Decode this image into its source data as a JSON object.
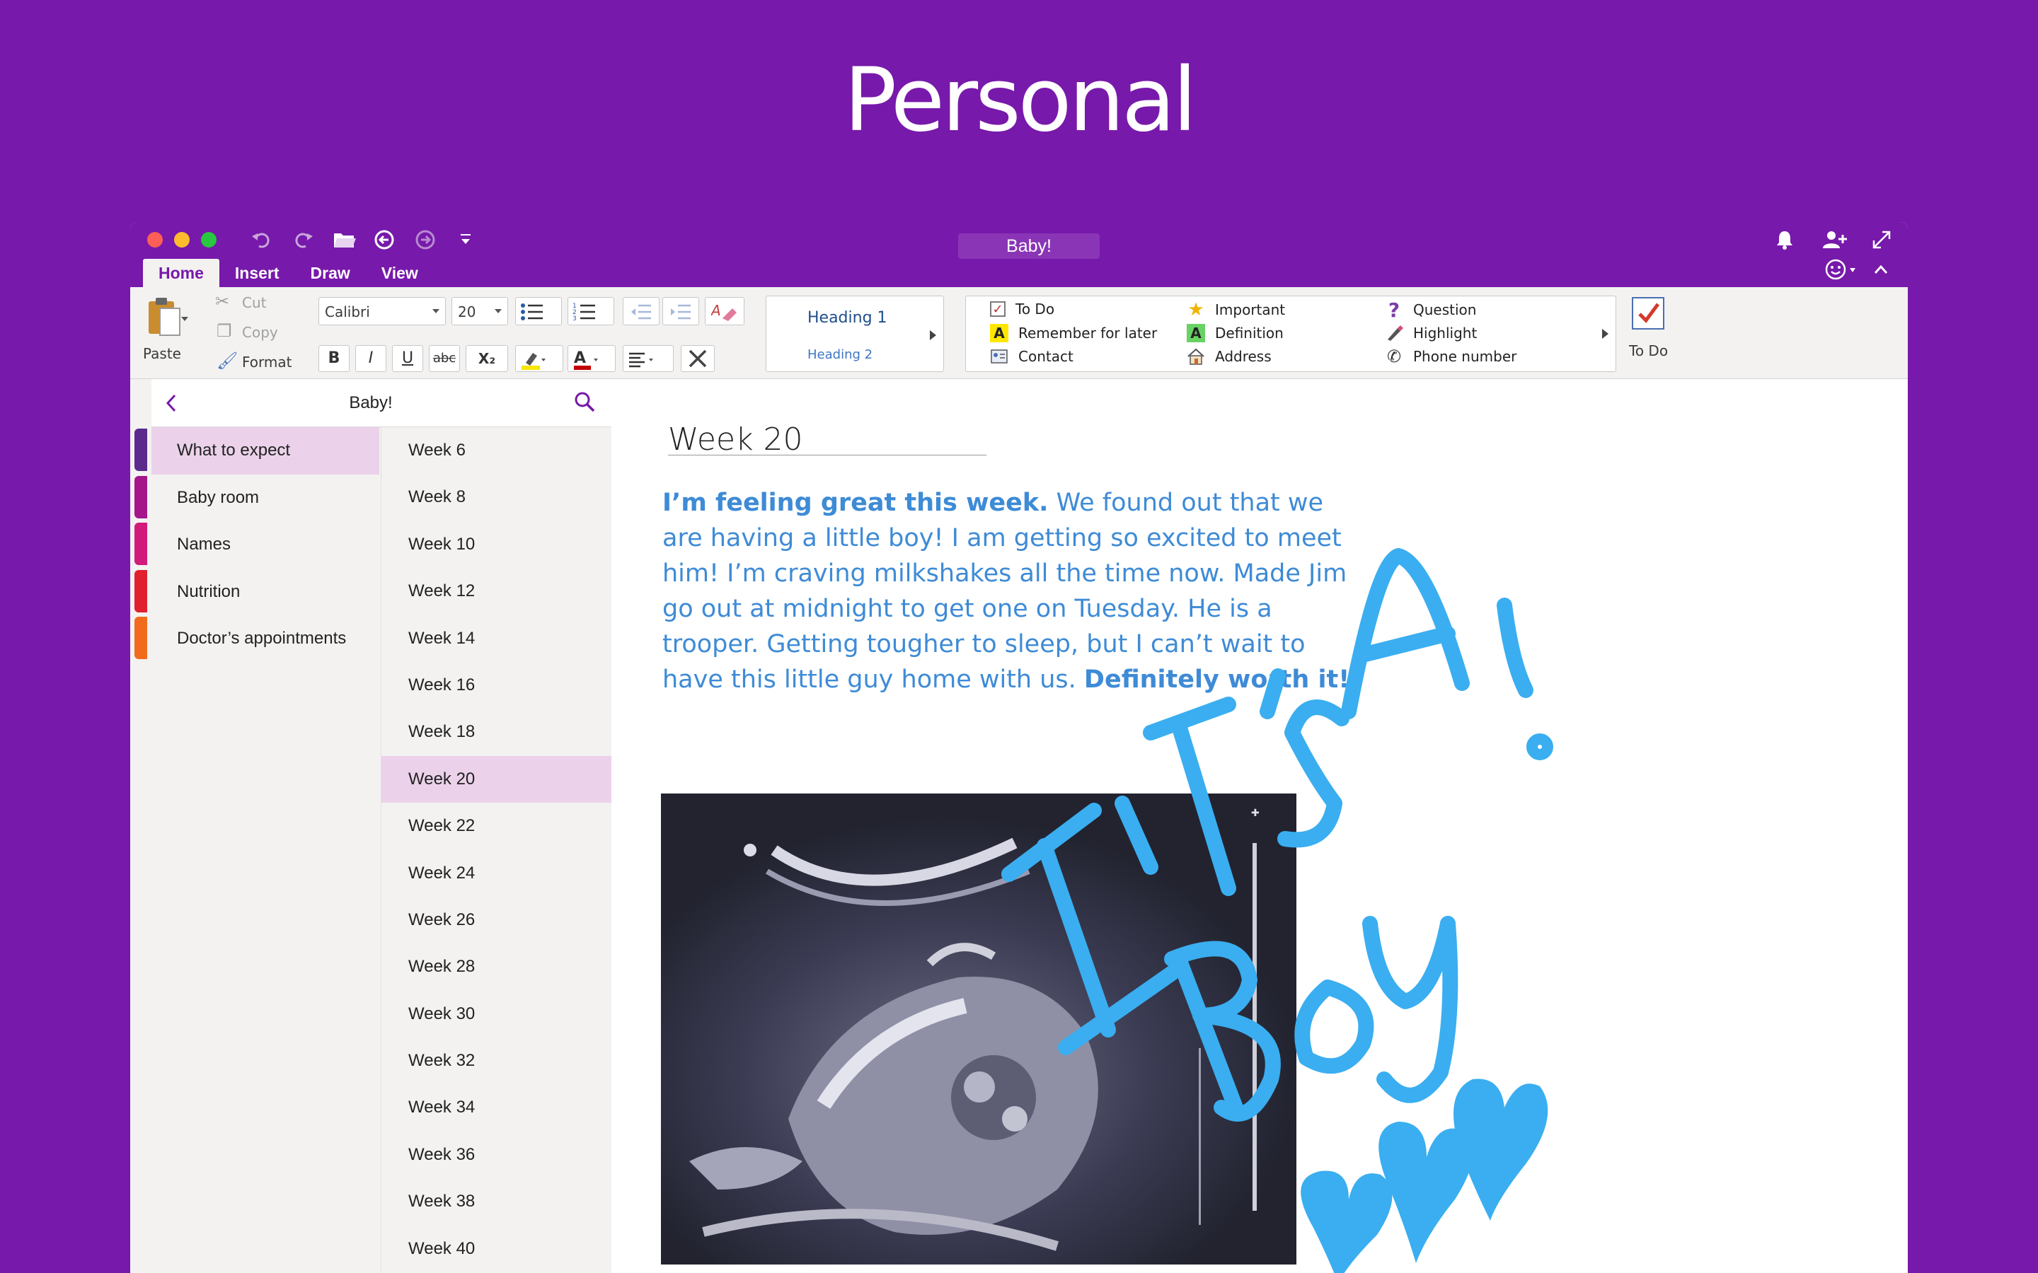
{
  "hero": {
    "title": "Personal"
  },
  "window": {
    "title": "Baby!",
    "tabs": [
      "Home",
      "Insert",
      "Draw",
      "View"
    ],
    "active_tab": "Home"
  },
  "ribbon": {
    "paste": "Paste",
    "cut": "Cut",
    "copy": "Copy",
    "format": "Format",
    "font_name": "Calibri",
    "font_size": "20",
    "bold": "B",
    "italic": "I",
    "underline": "U",
    "strike": "abc",
    "subscript": "X₂",
    "styles": {
      "heading1": "Heading 1",
      "heading2": "Heading 2"
    },
    "tags": {
      "todo": "To Do",
      "remember": "Remember for later",
      "contact": "Contact",
      "important": "Important",
      "definition": "Definition",
      "address": "Address",
      "question": "Question",
      "highlight": "Highlight",
      "phone": "Phone number"
    },
    "todo_button": "To Do"
  },
  "navigation": {
    "notebook_title": "Baby!",
    "sections": [
      {
        "label": "What to expect",
        "color": "#5b2a8c"
      },
      {
        "label": "Baby room",
        "color": "#a4168a"
      },
      {
        "label": "Names",
        "color": "#d11a7a"
      },
      {
        "label": "Nutrition",
        "color": "#e0202e"
      },
      {
        "label": "Doctor’s appointments",
        "color": "#f26b1d"
      }
    ],
    "selected_section": "What to expect",
    "pages": [
      "Week 6",
      "Week 8",
      "Week 10",
      "Week 12",
      "Week 14",
      "Week 16",
      "Week 18",
      "Week 20",
      "Week 22",
      "Week 24",
      "Week 26",
      "Week 28",
      "Week 30",
      "Week 32",
      "Week 34",
      "Week 36",
      "Week 38",
      "Week 40"
    ],
    "selected_page": "Week 20"
  },
  "page": {
    "title": "Week 20",
    "note_bold_1": "I’m feeling great this week.",
    "note_body": " We found out that we are having a little boy! I am getting so excited to meet him! I’m craving milkshakes all the time now. Made Jim go out at midnight to get one on Tuesday. He is a trooper. Getting tougher to sleep, but I can’t wait to have this little guy home with us. ",
    "note_bold_2": "Definitely worth it!",
    "ink_text": "It’s A Boy!",
    "ink_color": "#3aaef0"
  }
}
